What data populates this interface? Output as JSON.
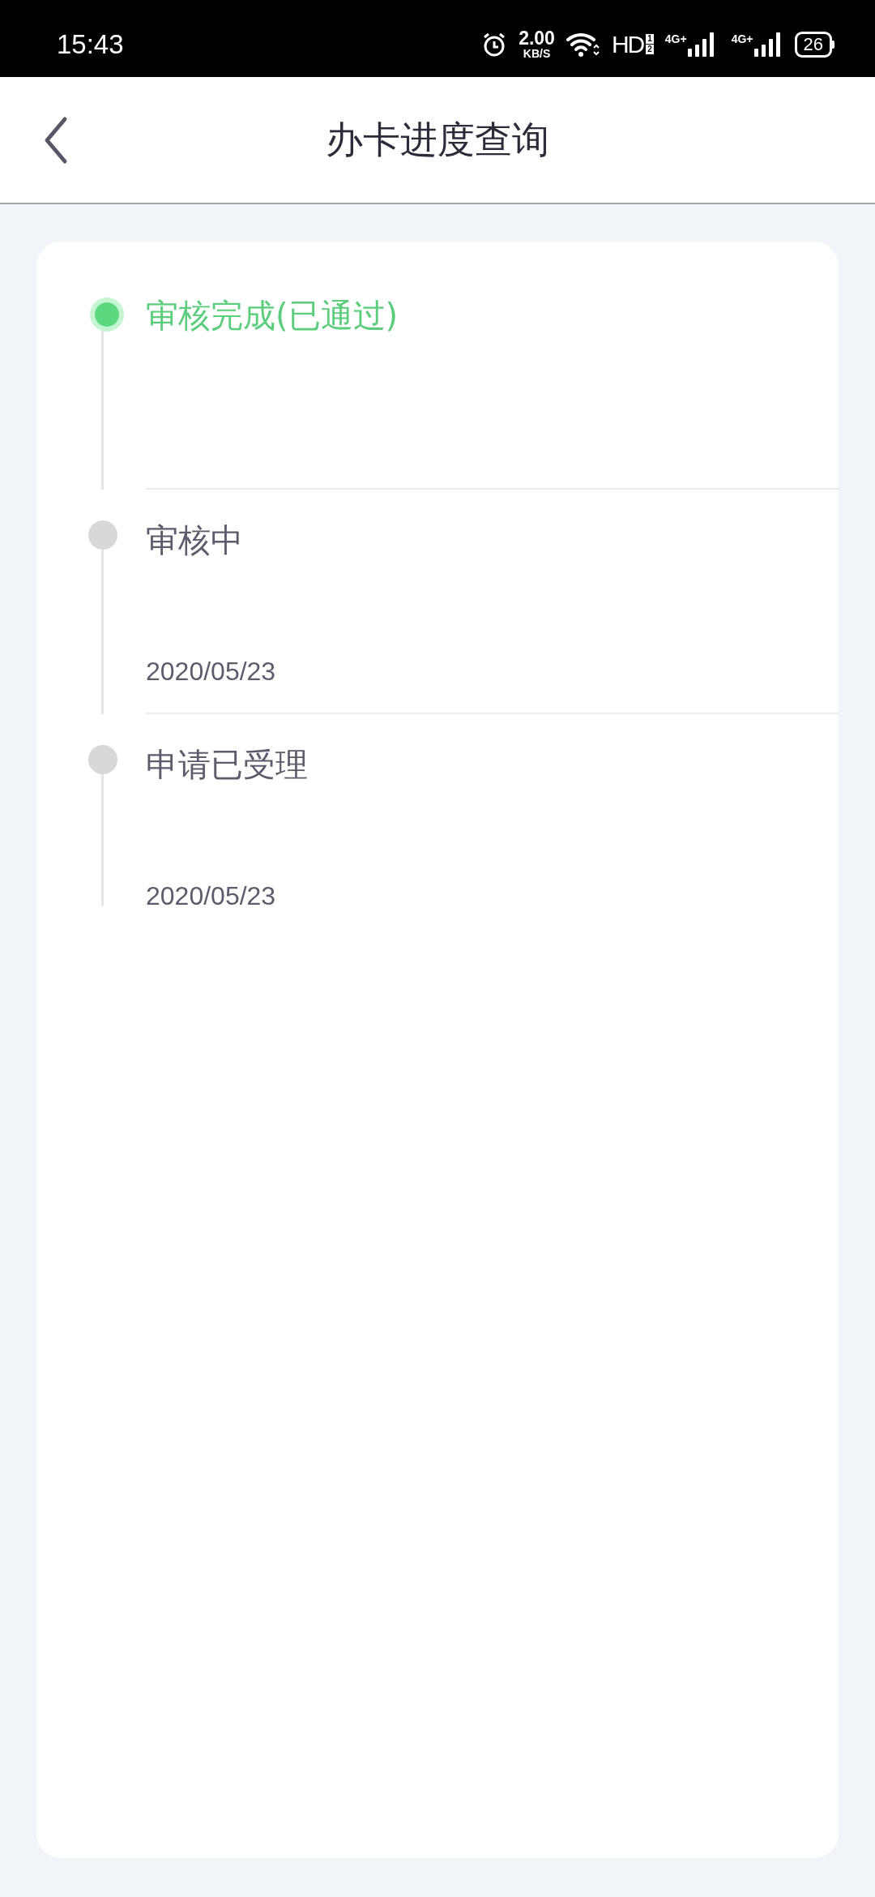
{
  "status_bar": {
    "time": "15:43",
    "net_speed": "2.00",
    "net_unit": "KB/S",
    "hd": "HD",
    "hd_slots": [
      "1",
      "2"
    ],
    "networks": [
      {
        "label": "4G+"
      },
      {
        "label": "4G+"
      }
    ],
    "battery": "26"
  },
  "header": {
    "title": "办卡进度查询"
  },
  "steps": [
    {
      "title": "审核完成(已通过)",
      "completed": true
    },
    {
      "title": "审核中",
      "date": "2020/05/23",
      "completed": false
    },
    {
      "title": "申请已受理",
      "date": "2020/05/23",
      "completed": false
    }
  ]
}
